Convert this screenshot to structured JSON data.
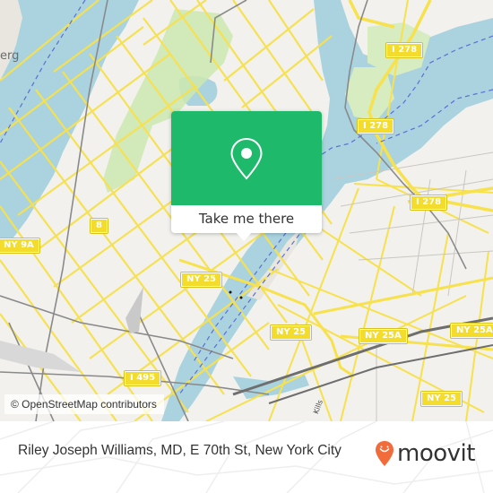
{
  "map": {
    "place_labels": [
      {
        "text": "erg"
      }
    ],
    "road_labels": [
      {
        "text": "Kills"
      }
    ],
    "shields": [
      {
        "label": "I 278"
      },
      {
        "label": "I 278"
      },
      {
        "label": "I 278"
      },
      {
        "label": "8"
      },
      {
        "label": "NY 9A"
      },
      {
        "label": "NY 25"
      },
      {
        "label": "NY 25"
      },
      {
        "label": "NY 25"
      },
      {
        "label": "NY 25A"
      },
      {
        "label": "NY 25A"
      },
      {
        "label": "I 495"
      }
    ],
    "colors": {
      "water": "#aad3df",
      "land": "#f2f1ed",
      "park": "#cde8b0",
      "road_major": "#f7e14c",
      "rail": "#8a8a8a",
      "ferry": "#5a6fd6"
    },
    "attribution": "© OpenStreetMap contributors"
  },
  "popup": {
    "icon": "location-pin-icon",
    "button_label": "Take me there",
    "color": "#1fb96b"
  },
  "footer": {
    "place_text": "Riley Joseph Williams, MD, E 70th St, New York City",
    "logo_text": "moovit",
    "logo_color": "#f26b3a"
  }
}
